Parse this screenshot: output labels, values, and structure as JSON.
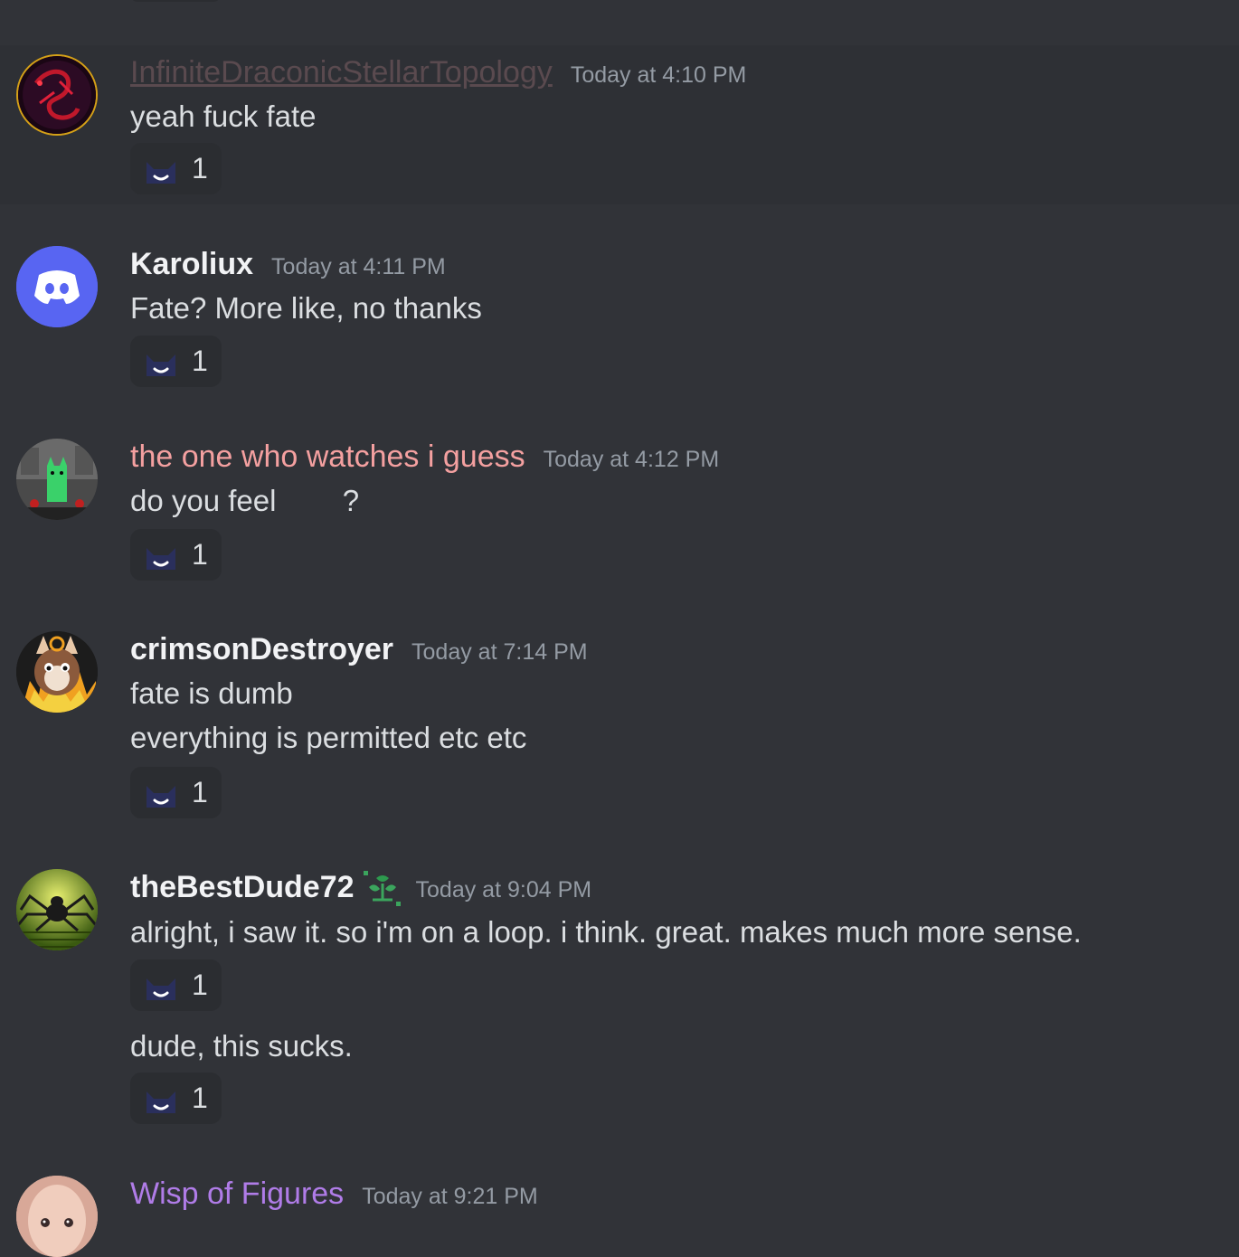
{
  "messages": [
    {
      "username": "InfiniteDraconicStellarTopology",
      "username_color": "#5a4a4f",
      "timestamp": "Today at 4:10 PM",
      "lines": [
        "yeah fuck fate"
      ],
      "reaction": {
        "emoji": "smiling-cat-emoji",
        "count": "1"
      }
    },
    {
      "username": "Karoliux",
      "username_color": "#f2f3f5",
      "timestamp": "Today at 4:11 PM",
      "lines": [
        "Fate? More like, no thanks"
      ],
      "reaction": {
        "emoji": "smiling-cat-emoji",
        "count": "1"
      }
    },
    {
      "username": "the one who watches i guess",
      "username_color": "#f4a0a0",
      "timestamp": "Today at 4:12 PM",
      "lines": [
        "do you feel        ?"
      ],
      "reaction": {
        "emoji": "smiling-cat-emoji",
        "count": "1"
      }
    },
    {
      "username": "crimsonDestroyer",
      "username_color": "#f2f3f5",
      "timestamp": "Today at 7:14 PM",
      "lines": [
        "fate is dumb",
        "everything is permitted etc etc"
      ],
      "reaction": {
        "emoji": "smiling-cat-emoji",
        "count": "1"
      }
    },
    {
      "username": "theBestDude72",
      "username_color": "#f2f3f5",
      "timestamp": "Today at 9:04 PM",
      "lines": [
        "alright, i saw it. so i'm on a loop. i think. great. makes much more sense."
      ],
      "reaction": {
        "emoji": "smiling-cat-emoji",
        "count": "1"
      },
      "followup": {
        "lines": [
          "dude, this sucks."
        ],
        "reaction": {
          "emoji": "smiling-cat-emoji",
          "count": "1"
        }
      }
    },
    {
      "username": "Wisp of Figures",
      "username_color": "#b07ce8",
      "timestamp": "Today at 9:21 PM",
      "lines": []
    }
  ],
  "colors": {
    "background": "#313338",
    "highlight_row": "#2e3035",
    "reaction_bg": "#2b2d31",
    "timestamp": "#949ba4",
    "discord_blurple": "#5865f2"
  }
}
